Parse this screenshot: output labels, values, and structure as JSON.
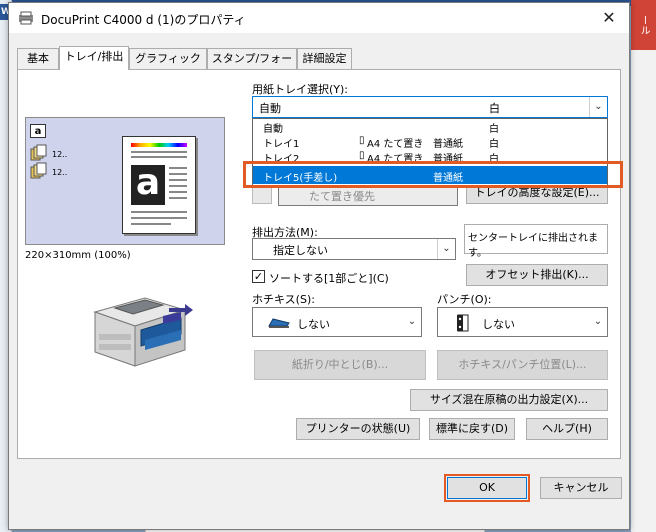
{
  "background": {
    "left_app_icon": "W",
    "right_tab_text": "ール"
  },
  "window": {
    "title": "DocuPrint C4000 d (1)のプロパティ",
    "close_glyph": "✕"
  },
  "tabs": [
    "基本",
    "トレイ/排出",
    "グラフィックス",
    "スタンプ/フォーム",
    "詳細設定"
  ],
  "active_tab": "トレイ/排出",
  "preview": {
    "size_label": "220×310mm (100%)",
    "icon_labels": [
      "a",
      "12..",
      "12.."
    ]
  },
  "paper_tray": {
    "label": "用紙トレイ選択(Y):",
    "value": "自動",
    "value_col": "白",
    "options": [
      {
        "name": "自動",
        "size": "",
        "type": "",
        "color": "白"
      },
      {
        "name": "トレイ1",
        "size": "A4 たて置き",
        "type": "普通紙",
        "color": "白"
      },
      {
        "name": "トレイ2",
        "size": "A4 たて置き",
        "type": "普通紙",
        "color": "白"
      },
      {
        "name": "トレイ5(手差し)",
        "size": "",
        "type": "普通紙",
        "color": ""
      }
    ],
    "selected_index": 3
  },
  "orientation": {
    "value": "たて置き優先"
  },
  "tray_advanced_button": "トレイの高度な設定(E)...",
  "output": {
    "label": "排出方法(M):",
    "value": "指定しない",
    "info": "センタートレイに排出されます。"
  },
  "collate": {
    "label": "ソートする[1部ごと](C)",
    "checked": true,
    "check_glyph": "✓"
  },
  "offset_button": "オフセット排出(K)...",
  "staple": {
    "label": "ホチキス(S):",
    "value": "しない"
  },
  "punch": {
    "label": "パンチ(O):",
    "value": "しない"
  },
  "fold_button": "紙折り/中とじ(B)...",
  "staple_position_button": "ホチキス/パンチ位置(L)...",
  "mixed_size_button": "サイズ混在原稿の出力設定(X)...",
  "printer_status_button": "プリンターの状態(U)",
  "restore_defaults_button": "標準に戻す(D)",
  "help_button": "ヘルプ(H)",
  "ok_button": "OK",
  "cancel_button": "キャンセル",
  "arrow_glyph": "⌄",
  "colors": {
    "accent": "#0078d7",
    "highlight": "#e35b24",
    "preview_bg": "#cfd3ec"
  }
}
